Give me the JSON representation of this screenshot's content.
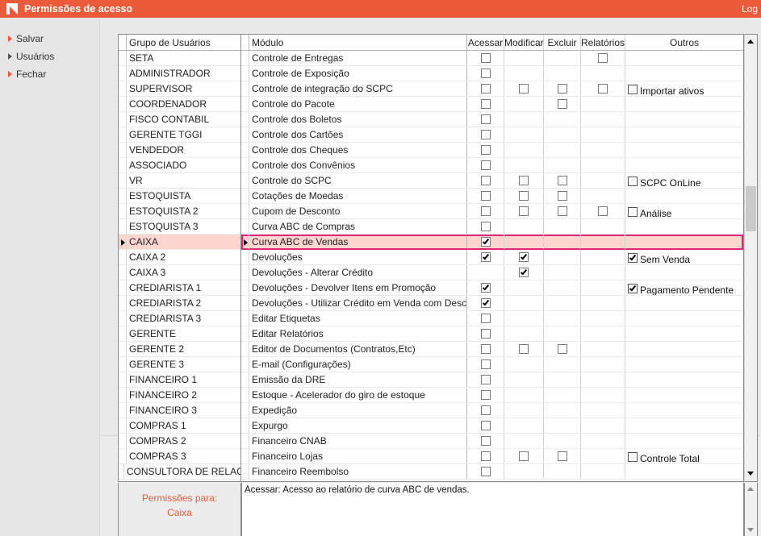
{
  "window": {
    "title": "Permissões de acesso",
    "log_label": "Log",
    "accent_color": "#ec5a3c"
  },
  "sidebar": {
    "items": [
      {
        "label": "Salvar",
        "icon": "arrow-right-icon"
      },
      {
        "label": "Usuários",
        "icon": "arrow-right-icon"
      },
      {
        "label": "Fechar",
        "icon": "arrow-right-icon"
      }
    ]
  },
  "groups": {
    "header": "Grupo de Usuários",
    "selected": "CAIXA",
    "items": [
      "SETA",
      "ADMINISTRADOR",
      "SUPERVISOR",
      "COORDENADOR",
      "FISCO CONTABIL",
      "GERENTE TGGI",
      "VENDEDOR",
      "ASSOCIADO",
      "VR",
      "ESTOQUISTA",
      "ESTOQUISTA 2",
      "ESTOQUISTA 3",
      "CAIXA",
      "CAIXA 2",
      "CAIXA 3",
      "CREDIARISTA 1",
      "CREDIARISTA 2",
      "CREDIARISTA 3",
      "GERENTE",
      "GERENTE 2",
      "GERENTE 3",
      "FINANCEIRO 1",
      "FINANCEIRO 2",
      "FINANCEIRO 3",
      "COMPRAS 1",
      "COMPRAS 2",
      "COMPRAS 3",
      "CONSULTORA DE RELACIONAMENTO"
    ]
  },
  "grid": {
    "headers": {
      "modulo": "Módulo",
      "acessar": "Acessar",
      "modificar": "Modificar",
      "excluir": "Excluir",
      "relatorios": "Relatórios",
      "outros": "Outros"
    },
    "selected_row": "Curva ABC de Vendas",
    "rows": [
      {
        "modulo": "Controle de Entregas",
        "a": false,
        "m": null,
        "e": null,
        "r": false,
        "o": null
      },
      {
        "modulo": "Controle de Exposição",
        "a": false,
        "m": null,
        "e": null,
        "r": null,
        "o": null
      },
      {
        "modulo": "Controle de integração do SCPC",
        "a": false,
        "m": false,
        "e": false,
        "r": false,
        "o": {
          "label": "Importar ativos",
          "checked": false
        }
      },
      {
        "modulo": "Controle do Pacote",
        "a": false,
        "m": null,
        "e": false,
        "r": null,
        "o": null
      },
      {
        "modulo": "Controle dos Boletos",
        "a": false,
        "m": null,
        "e": null,
        "r": null,
        "o": null
      },
      {
        "modulo": "Controle dos Cartões",
        "a": false,
        "m": null,
        "e": null,
        "r": null,
        "o": null
      },
      {
        "modulo": "Controle dos Cheques",
        "a": false,
        "m": null,
        "e": null,
        "r": null,
        "o": null
      },
      {
        "modulo": "Controle dos Convênios",
        "a": false,
        "m": null,
        "e": null,
        "r": null,
        "o": null
      },
      {
        "modulo": "Controle do SCPC",
        "a": false,
        "m": false,
        "e": false,
        "r": null,
        "o": {
          "label": "SCPC OnLine",
          "checked": false
        }
      },
      {
        "modulo": "Cotações de Moedas",
        "a": false,
        "m": false,
        "e": false,
        "r": null,
        "o": null
      },
      {
        "modulo": "Cupom de Desconto",
        "a": false,
        "m": false,
        "e": false,
        "r": false,
        "o": {
          "label": "Análise",
          "checked": false
        }
      },
      {
        "modulo": "Curva ABC de Compras",
        "a": false,
        "m": null,
        "e": null,
        "r": null,
        "o": null
      },
      {
        "modulo": "Curva ABC de Vendas",
        "a": true,
        "m": null,
        "e": null,
        "r": null,
        "o": null
      },
      {
        "modulo": "Devoluções",
        "a": true,
        "m": true,
        "e": null,
        "r": null,
        "o": {
          "label": "Sem Venda",
          "checked": true
        }
      },
      {
        "modulo": "Devoluções - Alterar Crédito",
        "a": null,
        "m": true,
        "e": null,
        "r": null,
        "o": null
      },
      {
        "modulo": "Devoluções - Devolver Itens em Promoção",
        "a": true,
        "m": null,
        "e": null,
        "r": null,
        "o": {
          "label": "Pagamento Pendente",
          "checked": true
        }
      },
      {
        "modulo": "Devoluções - Utilizar Crédito em Venda com Desconto",
        "a": true,
        "m": null,
        "e": null,
        "r": null,
        "o": null
      },
      {
        "modulo": "Editar Etiquetas",
        "a": false,
        "m": null,
        "e": null,
        "r": null,
        "o": null
      },
      {
        "modulo": "Editar Relatórios",
        "a": false,
        "m": null,
        "e": null,
        "r": null,
        "o": null
      },
      {
        "modulo": "Editor de Documentos (Contratos,Etc)",
        "a": false,
        "m": false,
        "e": false,
        "r": null,
        "o": null
      },
      {
        "modulo": "E-mail (Configurações)",
        "a": false,
        "m": null,
        "e": null,
        "r": null,
        "o": null
      },
      {
        "modulo": "Emissão da DRE",
        "a": false,
        "m": null,
        "e": null,
        "r": null,
        "o": null
      },
      {
        "modulo": "Estoque - Acelerador do giro de estoque",
        "a": false,
        "m": null,
        "e": null,
        "r": null,
        "o": null
      },
      {
        "modulo": "Expedição",
        "a": false,
        "m": null,
        "e": null,
        "r": null,
        "o": null
      },
      {
        "modulo": "Expurgo",
        "a": false,
        "m": null,
        "e": null,
        "r": null,
        "o": null
      },
      {
        "modulo": "Financeiro CNAB",
        "a": false,
        "m": null,
        "e": null,
        "r": null,
        "o": null
      },
      {
        "modulo": "Financeiro Lojas",
        "a": false,
        "m": false,
        "e": false,
        "r": null,
        "o": {
          "label": "Controle Total",
          "checked": false
        }
      },
      {
        "modulo": "Financeiro Reembolso",
        "a": false,
        "m": null,
        "e": null,
        "r": null,
        "o": null
      }
    ]
  },
  "footer": {
    "perm_label": "Permissões para:",
    "perm_value": "Caixa",
    "description": "Acessar: Acesso ao relatório de curva ABC de vendas."
  }
}
